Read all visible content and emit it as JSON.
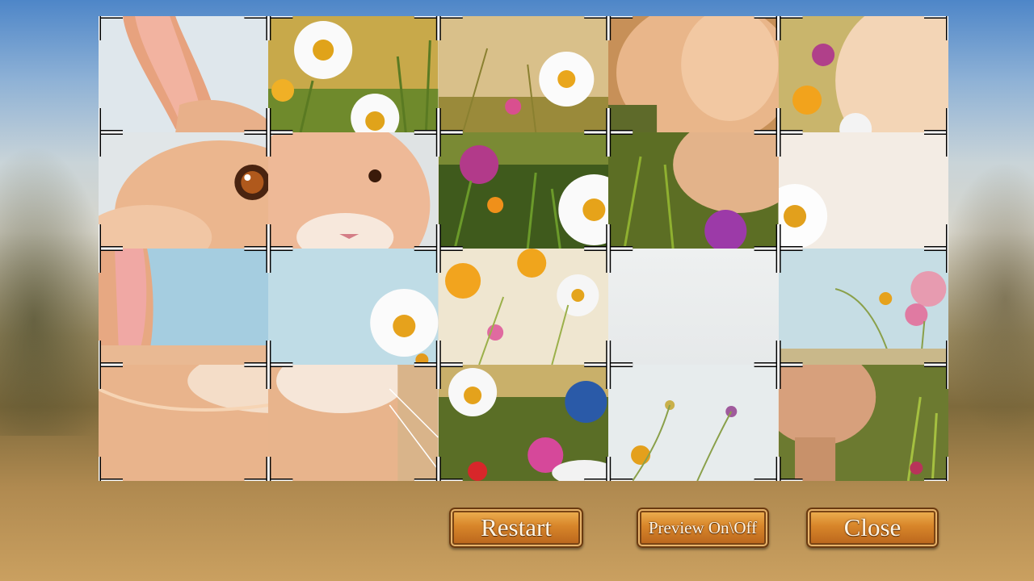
{
  "game": {
    "board": {
      "columns": 5,
      "rows": 4,
      "empty_tile": {
        "row": 2,
        "col": 3
      }
    },
    "buttons": {
      "restart_label": "Restart",
      "preview_label": "Preview On\\Off",
      "close_label": "Close"
    },
    "colors": {
      "button_top": "#f2b95a",
      "button_bottom": "#b5601a",
      "button_border": "#6a3a10",
      "button_text": "#fff6e6"
    },
    "icons": [
      "crosshair-marker-icon",
      "corner-bracket-icon"
    ]
  }
}
